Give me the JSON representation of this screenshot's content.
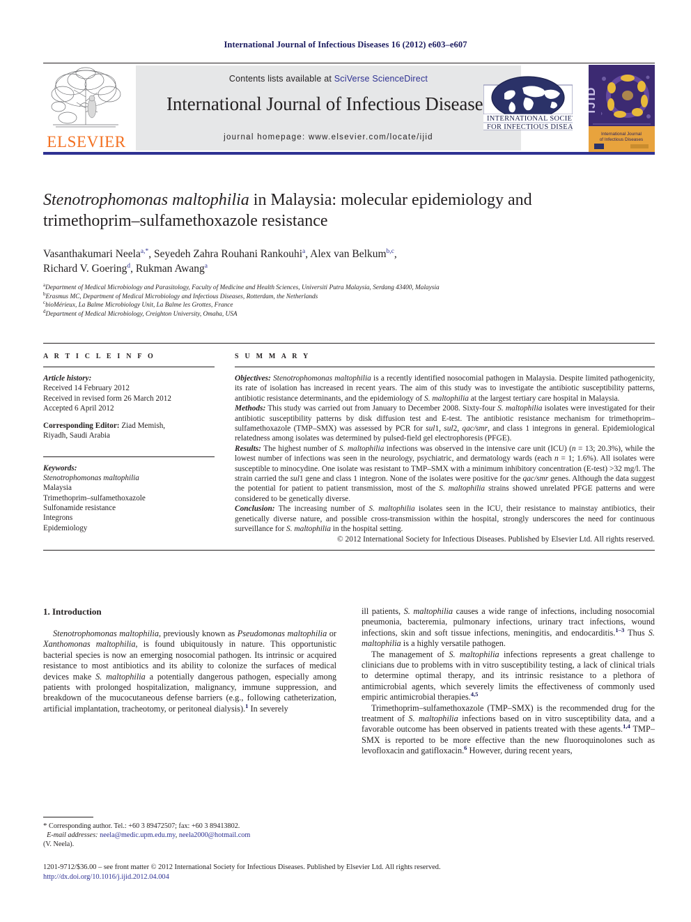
{
  "running_head": "International Journal of Infectious Diseases 16 (2012) e603–e607",
  "masthead": {
    "publisher_logo_label": "ELSEVIER",
    "contents_prefix": "Contents lists available at ",
    "contents_link": "SciVerse ScienceDirect",
    "journal_title": "International Journal of Infectious Diseases",
    "homepage_line": "journal homepage: www.elsevier.com/locate/ijid",
    "society_line_1": "INTERNATIONAL SOCIETY",
    "society_line_2": "FOR INFECTIOUS DISEASES",
    "cover_spine": "IJID",
    "cover_title_1": "International Journal",
    "cover_title_2": "of Infectious Diseases",
    "accent_color": "#2e3192",
    "elsevier_orange": "#f37021"
  },
  "article": {
    "title_part_italic_1": "Stenotrophomonas maltophilia",
    "title_part_rest_1": " in Malaysia: molecular epidemiology and",
    "title_line_2": "trimethoprim–sulfamethoxazole resistance",
    "authors_line_1_a": "Vasanthakumari Neela",
    "authors_sup_1a": "a,*",
    "authors_line_1_b": ", Seyedeh Zahra Rouhani Rankouhi",
    "authors_sup_1b": "a",
    "authors_line_1_c": ", Alex van Belkum",
    "authors_sup_1c": "b,c",
    "authors_line_1_d": ",",
    "authors_line_2_a": "Richard V. Goering",
    "authors_sup_2a": "d",
    "authors_line_2_b": ", Rukman Awang",
    "authors_sup_2b": "a",
    "affiliations": [
      {
        "mark": "a",
        "text": "Department of Medical Microbiology and Parasitology, Faculty of Medicine and Health Sciences, Universiti Putra Malaysia, Serdang 43400, Malaysia"
      },
      {
        "mark": "b",
        "text": "Erasmus MC, Department of Medical Microbiology and Infectious Diseases, Rotterdam, the Netherlands"
      },
      {
        "mark": "c",
        "text": "bioMérieux, La Balme Microbiology Unit, La Balme les Grottes, France"
      },
      {
        "mark": "d",
        "text": "Department of Medical Microbiology, Creighton University, Omaha, USA"
      }
    ]
  },
  "article_info": {
    "heading": "A R T I C L E   I N F O",
    "history_label": "Article history:",
    "history": [
      "Received 14 February 2012",
      "Received in revised form 26 March 2012",
      "Accepted 6 April 2012"
    ],
    "corresponding_editor_label": "Corresponding Editor:",
    "corresponding_editor_value": " Ziad Memish,",
    "corresponding_editor_line2": "Riyadh, Saudi Arabia",
    "keywords_label": "Keywords:",
    "keywords": [
      "Stenotrophomonas maltophilia",
      "Malaysia",
      "Trimethoprim–sulfamethoxazole",
      "Sulfonamide resistance",
      "Integrons",
      "Epidemiology"
    ]
  },
  "summary": {
    "heading": "S U M M A R Y",
    "objectives_label": "Objectives:",
    "objectives_text_1": " ",
    "objectives_italic_1": "Stenotrophomonas maltophilia",
    "objectives_text_2": " is a recently identified nosocomial pathogen in Malaysia. Despite limited pathogenicity, its rate of isolation has increased in recent years. The aim of this study was to investigate the antibiotic susceptibility patterns, antibiotic resistance determinants, and the epidemiology of ",
    "objectives_italic_2": "S. maltophilia",
    "objectives_text_3": " at the largest tertiary care hospital in Malaysia.",
    "methods_label": "Methods:",
    "methods_text_1": " This study was carried out from January to December 2008. Sixty-four ",
    "methods_italic_1": "S. maltophilia",
    "methods_text_2": " isolates were investigated for their antibiotic susceptibility patterns by disk diffusion test and E-test. The antibiotic resistance mechanism for trimethoprim–sulfamethoxazole (TMP–SMX) was assessed by PCR for ",
    "methods_italic_2": "sul",
    "methods_text_3": "1, ",
    "methods_italic_3": "sul",
    "methods_text_4": "2, ",
    "methods_italic_4": "qac/smr",
    "methods_text_5": ", and class 1 integrons in general. Epidemiological relatedness among isolates was determined by pulsed-field gel electrophoresis (PFGE).",
    "results_label": "Results:",
    "results_text_1": " The highest number of ",
    "results_italic_1": "S. maltophilia",
    "results_text_2": " infections was observed in the intensive care unit (ICU) (",
    "results_italic_2": "n",
    "results_text_3": " = 13; 20.3%), while the lowest number of infections was seen in the neurology, psychiatric, and dermatology wards (each ",
    "results_italic_3": "n",
    "results_text_4": " = 1; 1.6%). All isolates were susceptible to minocydine. One isolate was resistant to TMP–SMX with a minimum inhibitory concentration (E-test) >32 mg/l. The strain carried the ",
    "results_italic_4": "sul",
    "results_text_5": "1 gene and class 1 integron. None of the isolates were positive for the ",
    "results_italic_5": "qac/smr",
    "results_text_6": " genes. Although the data suggest the potential for patient to patient transmission, most of the ",
    "results_italic_6": "S. maltophilia",
    "results_text_7": " strains showed unrelated PFGE patterns and were considered to be genetically diverse.",
    "conclusion_label": "Conclusion:",
    "conclusion_text_1": " The increasing number of ",
    "conclusion_italic_1": "S. maltophilia",
    "conclusion_text_2": " isolates seen in the ICU, their resistance to mainstay antibiotics, their genetically diverse nature, and possible cross-transmission within the hospital, strongly underscores the need for continuous surveillance for ",
    "conclusion_italic_2": "S. maltophilia",
    "conclusion_text_3": " in the hospital setting.",
    "copyright": "© 2012 International Society for Infectious Diseases. Published by Elsevier Ltd. All rights reserved."
  },
  "body": {
    "section_heading": "1. Introduction",
    "left_p1_i1": "Stenotrophomonas maltophilia",
    "left_p1_t1": ", previously known as ",
    "left_p1_i2": "Pseudomonas maltophilia",
    "left_p1_t2": " or ",
    "left_p1_i3": "Xanthomonas maltophilia",
    "left_p1_t3": ", is found ubiquitously in nature. This opportunistic bacterial species is now an emerging nosocomial pathogen. Its intrinsic or acquired resistance to most antibiotics and its ability to colonize the surfaces of medical devices make ",
    "left_p1_i4": "S. maltophilia",
    "left_p1_t4": " a potentially dangerous pathogen, especially among patients with prolonged hospitalization, malignancy, immune suppression, and breakdown of the mucocutaneous defense barriers (e.g., following catheterization, artificial implantation, tracheotomy, or peritoneal dialysis).",
    "left_p1_sup": "1",
    "left_p1_t5": " In severely",
    "right_p1_t1": "ill patients, ",
    "right_p1_i1": "S. maltophilia",
    "right_p1_t2": " causes a wide range of infections, including nosocomial pneumonia, bacteremia, pulmonary infections, urinary tract infections, wound infections, skin and soft tissue infections, meningitis, and endocarditis.",
    "right_p1_sup": "1–3",
    "right_p1_t3": " Thus ",
    "right_p1_i2": "S. maltophilia",
    "right_p1_t4": " is a highly versatile pathogen.",
    "right_p2_t1": "The management of ",
    "right_p2_i1": "S. maltophilia",
    "right_p2_t2": " infections represents a great challenge to clinicians due to problems with in vitro susceptibility testing, a lack of clinical trials to determine optimal therapy, and its intrinsic resistance to a plethora of antimicrobial agents, which severely limits the effectiveness of commonly used empiric antimicrobial therapies.",
    "right_p2_sup": "4,5",
    "right_p3_t1": "Trimethoprim–sulfamethoxazole (TMP–SMX) is the recommended drug for the treatment of ",
    "right_p3_i1": "S. maltophilia",
    "right_p3_t2": " infections based on in vitro susceptibility data, and a favorable outcome has been observed in patients treated with these agents.",
    "right_p3_sup1": "1,4",
    "right_p3_t3": " TMP–SMX is reported to be more effective than the new fluoroquinolones such as levofloxacin and gatifloxacin.",
    "right_p3_sup2": "6",
    "right_p3_t4": " However, during recent years,"
  },
  "footnote": {
    "star": "*",
    "corr_text": " Corresponding author. Tel.: +60 3 89472507; fax: +60 3 89413802.",
    "email_label": "E-mail addresses:",
    "email_1": "neela@medic.upm.edu.my",
    "email_sep": ", ",
    "email_2": "neela2000@hotmail.com",
    "email_owner": "(V. Neela)."
  },
  "bottom_matter": {
    "front_matter": "1201-9712/$36.00 – see front matter © 2012 International Society for Infectious Diseases. Published by Elsevier Ltd. All rights reserved.",
    "doi": "http://dx.doi.org/10.1016/j.ijid.2012.04.004"
  }
}
